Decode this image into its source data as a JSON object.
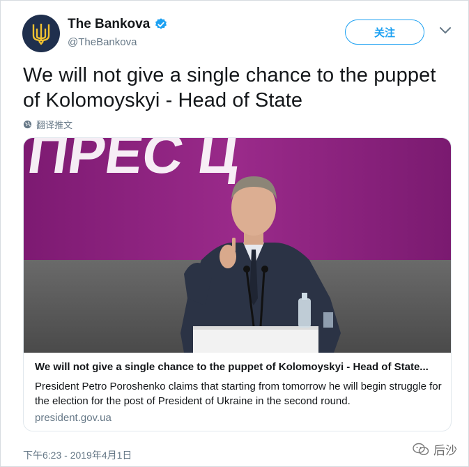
{
  "header": {
    "display_name": "The Bankova",
    "handle": "@TheBankova",
    "follow_label": "关注"
  },
  "tweet": {
    "text": "We will not give a single chance to the puppet of Kolomoyskyi - Head of State",
    "translate_label": "翻译推文"
  },
  "card": {
    "backdrop_text": "ПРЕС Ц",
    "title": "We will not give a single chance to the puppet of Kolomoyskyi - Head of State...",
    "description": "President Petro Poroshenko claims that starting from tomorrow he will begin struggle for the election for the post of President of Ukraine in the second round.",
    "domain": "president.gov.ua"
  },
  "footer": {
    "timestamp": "下午6:23 - 2019年4月1日",
    "watermark": "后沙"
  },
  "colors": {
    "link_blue": "#1da1f2",
    "muted_gray": "#657786",
    "avatar_navy": "#1f2f4d",
    "trident_gold": "#f2c230",
    "backdrop_magenta": "#8a1e7c"
  },
  "icons": {
    "verified": "verified-badge-icon",
    "caret": "chevron-down-icon",
    "globe": "globe-icon",
    "avatar": "ukraine-trident-icon",
    "watermark": "wechat-icon"
  }
}
